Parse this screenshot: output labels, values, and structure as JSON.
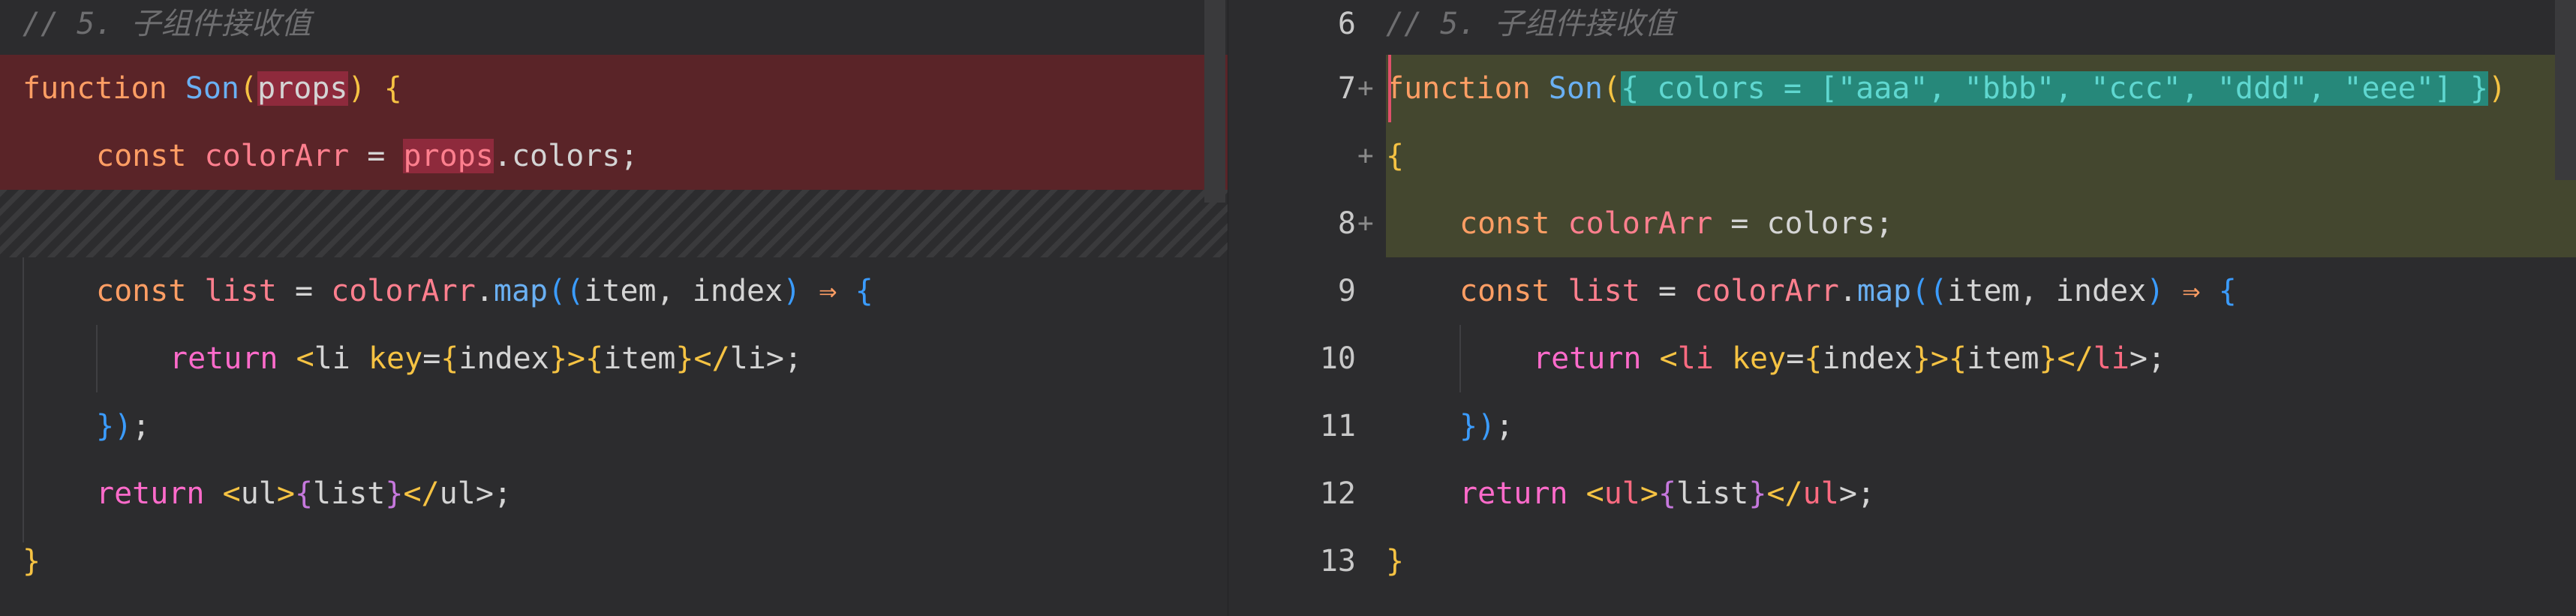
{
  "left": {
    "comment": "// 5. 子组件接收值",
    "line1": {
      "kw": "function",
      "fn": "Son",
      "p1": "(",
      "hl": "props",
      "p2": ")",
      "brace": "{"
    },
    "line2": {
      "kw": "const",
      "var": "colorArr",
      "eq": "=",
      "hl": "props",
      "rest": ".colors;"
    },
    "line3": {
      "kw": "const",
      "var": "list",
      "eq": "=",
      "obj": "colorArr",
      "dot": ".",
      "fn": "map",
      "p": "((",
      "args": "item, index",
      "pc": ")",
      "arrow": "⇒",
      "brace": "{"
    },
    "line4": {
      "ret": "return",
      "lt": "<",
      "tag": "li",
      "attr": "key",
      "eq": "=",
      "b1": "{",
      "v1": "index",
      "b2": "}",
      "gt": ">",
      "b3": "{",
      "v2": "item",
      "b4": "}",
      "close": "</",
      "tag2": "li",
      "end": ">;"
    },
    "line5": {
      "br": "})",
      "semi": ";"
    },
    "line6": {
      "ret": "return",
      "lt": "<",
      "tag": "ul",
      "gt": ">",
      "b1": "{",
      "v": "list",
      "b2": "}",
      "close": "</",
      "tag2": "ul",
      "end": ">;"
    },
    "line7": {
      "brace": "}"
    }
  },
  "right": {
    "arrow_icon": "→",
    "line_numbers": [
      "6",
      "7",
      "",
      "8",
      "9",
      "10",
      "11",
      "12",
      "13"
    ],
    "plus_marks": [
      "",
      "+",
      "+",
      "+",
      "",
      "",
      "",
      "",
      ""
    ],
    "comment": "// 5. 子组件接收值",
    "line1": {
      "kw": "function",
      "fn": "Son",
      "p1": "(",
      "hl": "{ colors = [\"aaa\", \"bbb\", \"ccc\", \"ddd\", \"eee\"] }",
      "p2": ")"
    },
    "line2": {
      "brace": "{"
    },
    "line3": {
      "kw": "const",
      "var": "colorArr",
      "eq": "=",
      "rest": "colors;"
    },
    "line4": {
      "kw": "const",
      "var": "list",
      "eq": "=",
      "obj": "colorArr",
      "dot": ".",
      "fn": "map",
      "p": "((",
      "args": "item, index",
      "pc": ")",
      "arrow": "⇒",
      "brace": "{"
    },
    "line5": {
      "ret": "return",
      "lt": "<",
      "tag": "li",
      "attr": "key",
      "eq": "=",
      "b1": "{",
      "v1": "index",
      "b2": "}",
      "gt": ">",
      "b3": "{",
      "v2": "item",
      "b4": "}",
      "close": "</",
      "tag2": "li",
      "end": ">;"
    },
    "line6": {
      "br": "})",
      "semi": ";"
    },
    "line7": {
      "ret": "return",
      "lt": "<",
      "tag": "ul",
      "gt": ">",
      "b1": "{",
      "v": "list",
      "b2": "}",
      "close": "</",
      "tag2": "ul",
      "end": ">;"
    },
    "line8": {
      "brace": "}"
    }
  },
  "colors": {
    "deleted_bg": "#5a2428",
    "added_bg": "#44472f",
    "del_highlight": "#8e2a3c",
    "add_highlight": "#26887a"
  }
}
